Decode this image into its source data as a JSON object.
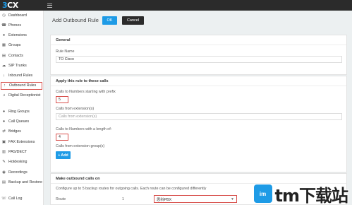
{
  "app": {
    "logo_main": "3",
    "logo_rest": "CX"
  },
  "sidebar": {
    "items": [
      {
        "label": "Dashboard",
        "icon": "dashboard-icon",
        "glyph": "◷"
      },
      {
        "label": "Phones",
        "icon": "phone-icon",
        "glyph": "☎"
      },
      {
        "label": "Extensions",
        "icon": "user-icon",
        "glyph": "●"
      },
      {
        "label": "Groups",
        "icon": "grid-icon",
        "glyph": "▦"
      },
      {
        "label": "Contacts",
        "icon": "contact-icon",
        "glyph": "▤"
      },
      {
        "label": "SIP Trunks",
        "icon": "cloud-icon",
        "glyph": "☁"
      },
      {
        "label": "Inbound Rules",
        "icon": "arrow-down-icon",
        "glyph": "↓"
      },
      {
        "label": "Outbound Rules",
        "icon": "arrow-up-icon",
        "glyph": "↑"
      },
      {
        "label": "Digital Receptionist",
        "icon": "receptionist-icon",
        "glyph": "♫"
      },
      {
        "label": "Ring Groups",
        "icon": "ring-group-icon",
        "glyph": "●"
      },
      {
        "label": "Call Queues",
        "icon": "queue-icon",
        "glyph": "●"
      },
      {
        "label": "Bridges",
        "icon": "bridge-icon",
        "glyph": "⇄"
      },
      {
        "label": "FAX Extensions",
        "icon": "fax-icon",
        "glyph": "▣"
      },
      {
        "label": "PAS/DECT",
        "icon": "dect-icon",
        "glyph": "▥"
      },
      {
        "label": "Hotdesking",
        "icon": "hotdesk-icon",
        "glyph": "✎"
      },
      {
        "label": "Recordings",
        "icon": "recording-icon",
        "glyph": "◉"
      },
      {
        "label": "Backup and Restore",
        "icon": "backup-icon",
        "glyph": "▤"
      },
      {
        "label": "Call Log",
        "icon": "call-log-icon",
        "glyph": "☏"
      }
    ]
  },
  "header": {
    "title": "Add Outbound Rule",
    "ok_label": "OK",
    "cancel_label": "Cancel"
  },
  "general": {
    "heading": "General",
    "rule_name_label": "Rule Name",
    "rule_name_value": "TO Cisco"
  },
  "apply": {
    "heading": "Apply this rule to these calls",
    "prefix_label": "Calls to Numbers starting with prefix",
    "prefix_value": "5",
    "from_ext_label": "Calls from extension(s)",
    "from_ext_placeholder": "Calls from extension(s)",
    "length_label": "Calls to Numbers with a length of:",
    "length_value": "4",
    "groups_label": "Calls from extension group(s)",
    "add_label": "Add"
  },
  "make": {
    "heading": "Make outbound calls on",
    "description": "Configure up to 5 backup routes for outgoing calls. Each route can be configured differently",
    "route_label": "Route",
    "route_number": "1",
    "route_value": "思科PBX"
  },
  "watermark": {
    "badge": "im",
    "text": "tm下载站"
  },
  "colors": {
    "accent": "#1e9be6",
    "highlight": "#d9534f",
    "topbar": "#2b2b2b"
  }
}
